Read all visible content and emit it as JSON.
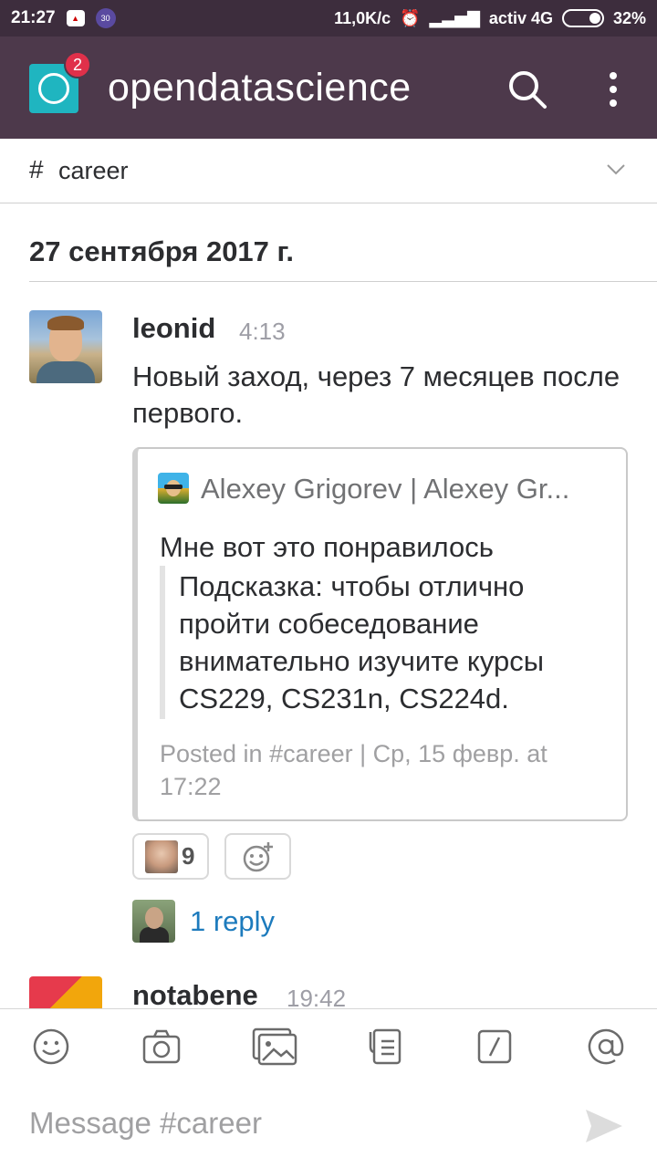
{
  "status_bar": {
    "time": "21:27",
    "icon_left_1": "notification-icon",
    "icon_left_2": "30",
    "network_speed": "11,0K/c",
    "carrier": "activ 4G",
    "battery": "32%"
  },
  "app_bar": {
    "team_name": "opendatascience",
    "badge_count": "2"
  },
  "channel": {
    "hash": "#",
    "name": "career"
  },
  "date_divider": "27 сентября 2017 г.",
  "message": {
    "user": "leonid",
    "time": "4:13",
    "text": "Новый заход, через 7 месяцев после первого.",
    "attachment": {
      "author": "Alexey Grigorev | Alexey Gr...",
      "text": "Мне вот это понравилось",
      "quote": "Подсказка: чтобы отлично пройти собеседование внимательно изучите курсы CS229, CS231n, CS224d.",
      "footer": "Posted in #career | Ср, 15 февр. at 17:22"
    },
    "reaction_count": "9",
    "reply_label": "1 reply"
  },
  "message2": {
    "user": "notabene",
    "time": "19:42"
  },
  "composer": {
    "placeholder": "Message #career"
  },
  "colors": {
    "status_bar": "#3d2d3d",
    "app_bar": "#4d394b",
    "team_logo": "#1fb5c0",
    "badge": "#e0304a",
    "link": "#1d7bbd"
  }
}
